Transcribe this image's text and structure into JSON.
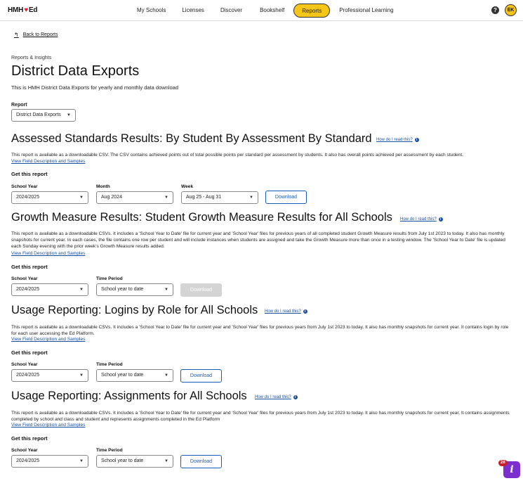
{
  "brand": {
    "name": "HMH",
    "heart": "♥",
    "product": "Ed"
  },
  "nav": {
    "items": [
      "My Schools",
      "Licenses",
      "Discover",
      "Bookshelf",
      "Reports",
      "Professional Learning"
    ],
    "active": "Reports",
    "help": "?",
    "avatar_initials": "EK"
  },
  "back_link": "Back to Reports",
  "breadcrumb": "Reports & Insights",
  "page_title": "District Data Exports",
  "page_subtitle": "This is HMH District Data Exports for yearly and monthly data download",
  "report_select": {
    "label": "Report",
    "value": "District Data Exports"
  },
  "how_to": "How do I read this?",
  "field_link": "View Field Description and Samples",
  "get_report": "Get this report",
  "sections": [
    {
      "title": "Assessed Standards Results: By Student By Assessment By Standard",
      "description": "This report is available as a downloadable CSV. The CSV contains achieved points out of total possible points per standard per assessment by students. It also has overall points achieved per assessment by each student.",
      "fields": [
        {
          "label": "School Year",
          "value": "2024/2025"
        },
        {
          "label": "Month",
          "value": "Aug 2024"
        },
        {
          "label": "Week",
          "value": "Aug 25 - Aug 31"
        }
      ],
      "button": "Download",
      "button_disabled": false
    },
    {
      "title": "Growth Measure Results: Student Growth Measure Results for All Schools",
      "description": "This report is available as a downloadable CSVs. It includes a 'School Year to Date' file for current year and 'School Year' files for previous years of all completed student Growth Measure results from July 1st 2023 to today. It also has monthly snapshots for current year. In each cases, the file contains one row per student and will include instances when students are assigned and take the Growth Measure more than once in a testing window. The 'School Year to Date' file is updated each Sunday evening with the prior week's Growth Measure results added.",
      "fields": [
        {
          "label": "School Year",
          "value": "2024/2025"
        },
        {
          "label": "Time Period",
          "value": "School year to date"
        }
      ],
      "button": "Download",
      "button_disabled": true
    },
    {
      "title": "Usage Reporting: Logins by Role for All Schools",
      "description": "This report is available as a downloadable CSVs. It includes a 'School Year to Date' file for current year and 'School Year' files for previous years from July 1st 2023 to today. It also has monthly snapshots for current year. It contains login by role for each user accessing the Ed Platform.",
      "fields": [
        {
          "label": "School Year",
          "value": "2024/2025"
        },
        {
          "label": "Time Period",
          "value": "School year to date"
        }
      ],
      "button": "Download",
      "button_disabled": false
    },
    {
      "title": "Usage Reporting: Assignments for All Schools",
      "description": "This report is available as a downloadable CSVs. It includes a 'School Year to Date' file for current year and 'School Year' files for previous years  from July 1st 2023 to today. It also has monthly snapshots for current year. It contains assignments completed by school and class and student and represents assignments completed in the Ed Platform",
      "fields": [
        {
          "label": "School Year",
          "value": "2024/2025"
        },
        {
          "label": "Time Period",
          "value": "School year to date"
        }
      ],
      "button": "Download",
      "button_disabled": false
    }
  ],
  "chat": {
    "count": "26",
    "glyph": "i"
  },
  "colors": {
    "accent": "#f5c518",
    "link": "#1a4fa0",
    "button": "#1a5bb8",
    "chat": "#7b2fd0"
  }
}
